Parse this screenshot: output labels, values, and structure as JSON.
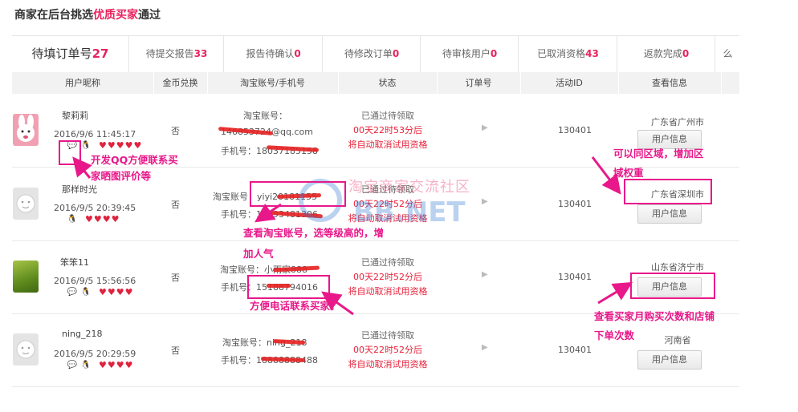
{
  "title": {
    "prefix": "商家在后台挑选",
    "highlight": "优质买家",
    "suffix": "通过"
  },
  "tabs": [
    {
      "label": "待填订单号",
      "count": "27"
    },
    {
      "label": "待提交报告",
      "count": "33"
    },
    {
      "label": "报告待确认",
      "count": "0"
    },
    {
      "label": "待修改订单",
      "count": "0"
    },
    {
      "label": "待审核用户",
      "count": "0"
    },
    {
      "label": "已取消资格",
      "count": "43"
    },
    {
      "label": "返款完成",
      "count": "0"
    },
    {
      "label": "么",
      "count": ""
    }
  ],
  "columns": [
    "用户昵称",
    "金币兑换",
    "淘宝账号/手机号",
    "状态",
    "订单号",
    "活动ID",
    "查看信息"
  ],
  "rows": [
    {
      "nick": "黎莉莉",
      "date": "2016/9/6 11:45:17",
      "coin": "否",
      "taobao": "淘宝账号：",
      "email": "146853724@qq.com",
      "phone": "手机号：18037185158",
      "status1": "已通过待领取",
      "status2": "00天22时53分后",
      "status3": "将自动取消试用资格",
      "activity": "130401",
      "province": "广东省广州市",
      "button": "用户信息"
    },
    {
      "nick": "那样时光",
      "date": "2016/9/5 20:39:45",
      "coin": "否",
      "taobao": "淘宝账号：yiyi20181155",
      "phone": "手机号：17093481306",
      "status1": "已通过待领取",
      "status2": "00天22时52分后",
      "status3": "将自动取消试用资格",
      "activity": "130401",
      "province": "广东省深圳市",
      "button": "用户信息"
    },
    {
      "nick": "笨笨11",
      "date": "2016/9/5 15:56:56",
      "coin": "否",
      "taobao": "淘宝账号：小雨家888",
      "phone": "手机号：15188794016",
      "status1": "已通过待领取",
      "status2": "00天22时52分后",
      "status3": "将自动取消试用资格",
      "activity": "130401",
      "province": "山东省济宁市",
      "button": "用户信息"
    },
    {
      "nick": "ning_218",
      "date": "2016/9/5 20:29:59",
      "coin": "否",
      "taobao": "淘宝账号：ning_218",
      "phone": "手机号：18888888488",
      "status1": "已通过待领取",
      "status2": "00天22时52分后",
      "status3": "将自动取消试用资格",
      "activity": "130401",
      "province": "河南省",
      "button": "用户信息"
    }
  ],
  "annotations": {
    "qq": [
      "开发QQ方便联系买",
      "家晒图评价等"
    ],
    "taobao": [
      "查看淘宝账号，选等级高的，增",
      "加人气"
    ],
    "phone": "方便电话联系买家。",
    "region": [
      "可以同区域，增加区",
      "域权重"
    ],
    "info": [
      "查看买家月购买次数和店铺",
      "下单次数"
    ]
  },
  "watermark": {
    "line1": "淘宝商家交流社区",
    "line2": "BB.NET"
  },
  "colors": {
    "accent": "#e8225d",
    "annotation": "#e8188a",
    "status_red": "#e8223a",
    "header_bg": "#f2f2f2"
  }
}
